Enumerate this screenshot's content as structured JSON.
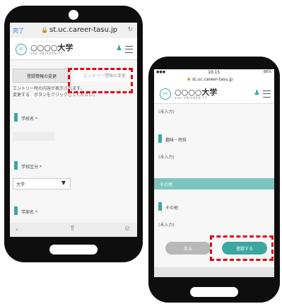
{
  "left_phone": {
    "url": "st.uc.career-tasu.jp",
    "back_label": "完了",
    "university_name": "○○○○大学",
    "university_sub": "ooo UNIVERSITY",
    "tab_basic": "登録情報の変更",
    "tab_entry": "エントリー情報の変更",
    "notice": "エントリー時の内容が表示されます。\n変更する　ボタンをクリックしてください。",
    "field1_label": "学校名 *",
    "field2_label": "学校区分 *",
    "select_value": "大学",
    "field3_label": "学部名 *"
  },
  "right_phone": {
    "status_time": "10:15",
    "status_battery": "88%",
    "url": "st.uc.career-tasu.jp",
    "university_name": "○○○○大学",
    "university_sub": "ooo UNIVERSITY",
    "text1": "(未入力)",
    "field1_label": "趣味・特技",
    "text2": "(未入力)",
    "section_title": "その他",
    "field2_label": "その他",
    "text3": "(未入力)",
    "button_back": "戻る",
    "button_submit": "登録する"
  },
  "colors": {
    "accent": "#3aa7a0",
    "highlight": "#e60012"
  }
}
